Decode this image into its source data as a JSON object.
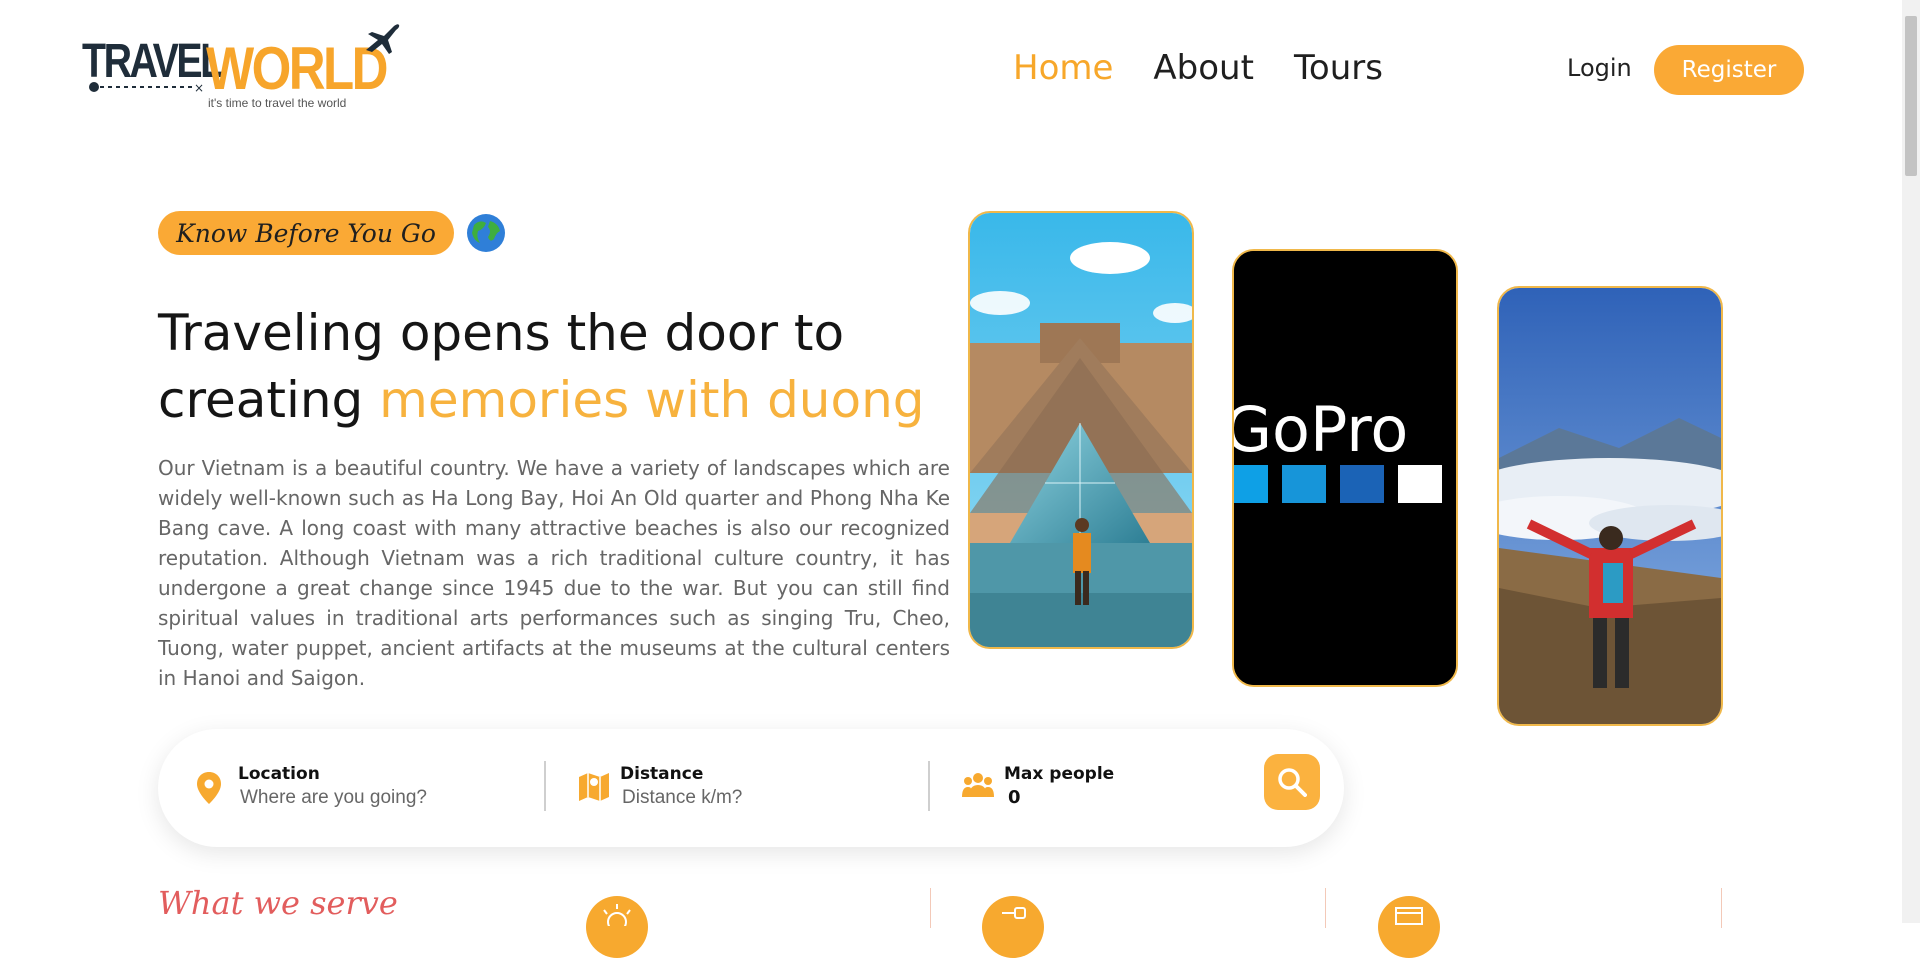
{
  "brand": {
    "name_part1": "TRAVEL",
    "name_part2": "WORLD",
    "tagline": "it's time to travel the world",
    "accent": "#faa935"
  },
  "nav": {
    "items": [
      {
        "label": "Home",
        "active": true
      },
      {
        "label": "About",
        "active": false
      },
      {
        "label": "Tours",
        "active": false
      }
    ],
    "login": "Login",
    "register": "Register"
  },
  "hero": {
    "badge": "Know Before You Go",
    "title_line1": "Traveling opens the door to",
    "title_line2_prefix": "creating ",
    "title_highlight": "memories with duong",
    "description": "Our Vietnam is a beautiful country. We have a variety of landscapes which are widely well-known such as Ha Long Bay, Hoi An Old quarter and Phong Nha Ke Bang cave. A long coast with many attractive beaches is also our recognized reputation. Although Vietnam was a rich traditional culture country, it has undergone a great change since 1945 due to the war. But you can still find spiritual values in traditional arts performances such as singing Tru, Cheo, Tuong, water puppet, ancient artifacts at the museums at the cultural centers in Hanoi and Saigon.",
    "images": [
      "louvre-pyramid-photo",
      "gopro-video",
      "mountain-hiker-photo"
    ],
    "gopro_text": "GoPro"
  },
  "search": {
    "location": {
      "label": "Location",
      "placeholder": "Where are you going?"
    },
    "distance": {
      "label": "Distance",
      "placeholder": "Distance k/m?"
    },
    "people": {
      "label": "Max people",
      "value": "0"
    }
  },
  "services": {
    "heading": "What we serve"
  }
}
